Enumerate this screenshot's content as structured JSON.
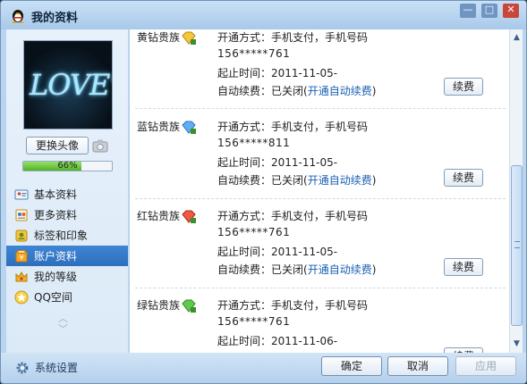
{
  "window": {
    "title": "我的资料",
    "buttons": {
      "minimize": "—",
      "maximize": "□",
      "close": "✕"
    }
  },
  "profile": {
    "avatar_text": "LOVE♡",
    "change_avatar_label": "更换头像",
    "completion": 0.66,
    "completion_text": "66%"
  },
  "nav": {
    "items": [
      {
        "label": "基本资料",
        "icon": "id-card-icon",
        "active": false
      },
      {
        "label": "更多资料",
        "icon": "contacts-icon",
        "active": false
      },
      {
        "label": "标签和印象",
        "icon": "tag-icon",
        "active": false
      },
      {
        "label": "账户资料",
        "icon": "account-icon",
        "active": true
      },
      {
        "label": "我的等级",
        "icon": "crown-icon",
        "active": false
      },
      {
        "label": "QQ空间",
        "icon": "qzone-star-icon",
        "active": false
      }
    ],
    "scroll_up": "︿",
    "scroll_down": "﹀"
  },
  "memberships": [
    {
      "name": "黄钻贵族",
      "badge": "yellow-diamond-icon",
      "color": "#e8b21b",
      "method": "开通方式：手机支付，手机号码",
      "phone": "156*****761",
      "start": "起止时间：2011-11-05-",
      "auto_renew_prefix": "自动续费：已关闭(",
      "auto_renew_link": "开通自动续费",
      "auto_renew_suffix": ")",
      "renew_label": "续费"
    },
    {
      "name": "蓝钻贵族",
      "badge": "blue-diamond-icon",
      "color": "#3d8fd9",
      "method": "开通方式：手机支付，手机号码",
      "phone": "156*****811",
      "start": "起止时间：2011-11-05-",
      "auto_renew_prefix": "自动续费：已关闭(",
      "auto_renew_link": "开通自动续费",
      "auto_renew_suffix": ")",
      "renew_label": "续费"
    },
    {
      "name": "红钻贵族",
      "badge": "red-diamond-icon",
      "color": "#d9412d",
      "method": "开通方式：手机支付，手机号码",
      "phone": "156*****761",
      "start": "起止时间：2011-11-05-",
      "auto_renew_prefix": "自动续费：已关闭(",
      "auto_renew_link": "开通自动续费",
      "auto_renew_suffix": ")",
      "renew_label": "续费"
    },
    {
      "name": "绿钻贵族",
      "badge": "green-diamond-icon",
      "color": "#3cab3a",
      "method": "开通方式：手机支付，手机号码",
      "phone": "156*****761",
      "start": "起止时间：2011-11-06-",
      "auto_renew_prefix": "",
      "auto_renew_link": "",
      "auto_renew_suffix": "",
      "renew_label": "续费"
    }
  ],
  "scrollbar": {
    "up": "▲",
    "down": "▼"
  },
  "footer": {
    "settings_label": "系统设置",
    "ok_label": "确定",
    "cancel_label": "取消",
    "apply_label": "应用"
  }
}
